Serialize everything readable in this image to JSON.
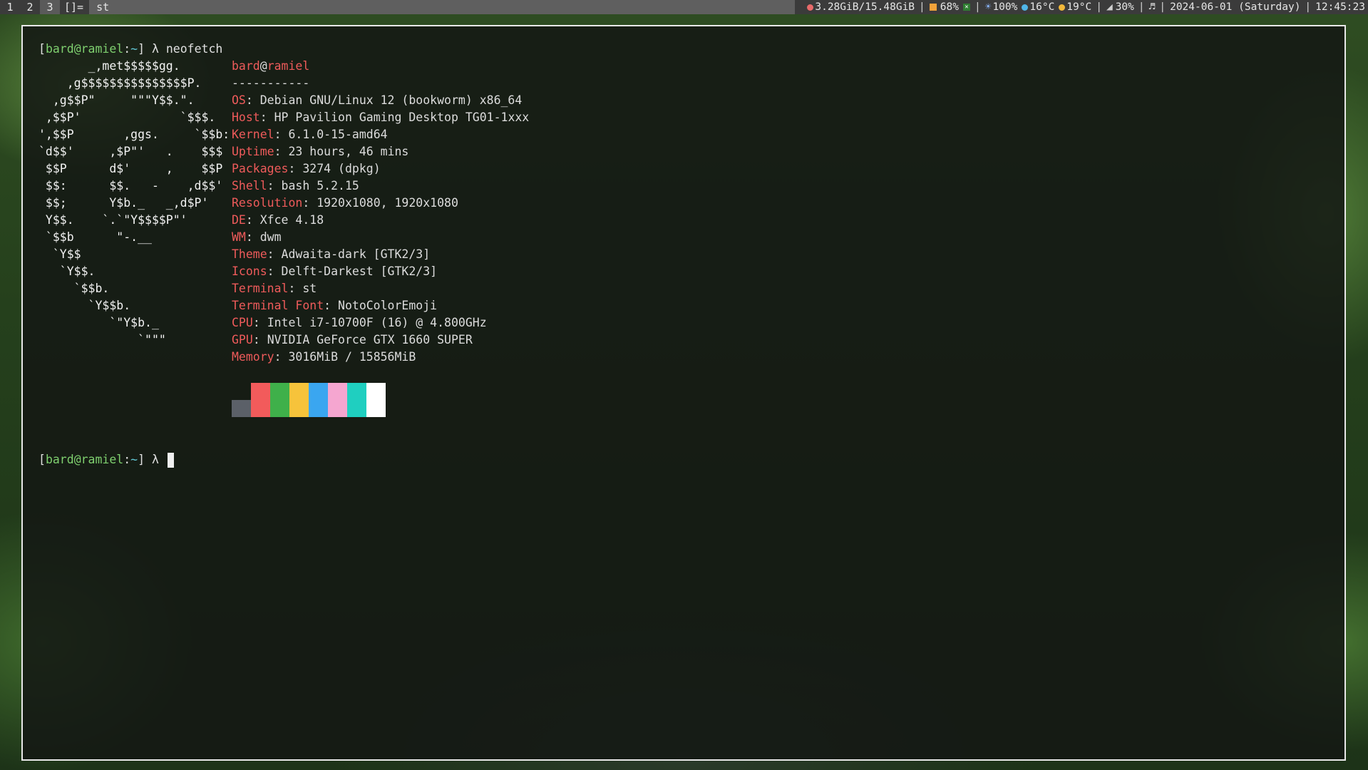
{
  "bar": {
    "tags": [
      "1",
      "2",
      "3"
    ],
    "active_tag": "3",
    "layout": "[]=",
    "window_title": "st",
    "memory": "3.28GiB/15.48GiB",
    "cpu": "68%",
    "brightness": "100%",
    "temp1": "16°C",
    "temp2": "19°C",
    "volume": "30%",
    "music": "♬",
    "date": "2024-06-01 (Saturday)",
    "time": "12:45:23",
    "icons": [
      "memory-icon",
      "cpu-icon",
      "cpu-status-icon",
      "brightness-icon",
      "weather-icon",
      "sun-icon",
      "volume-icon",
      "music-icon"
    ]
  },
  "terminal": {
    "prompt1": {
      "user": "bard",
      "host": "ramiel",
      "dir": "~",
      "symbol": "λ",
      "command": "neofetch"
    },
    "ascii_lines": [
      "       _,met$$$$$gg.",
      "    ,g$$$$$$$$$$$$$$$P.",
      "  ,g$$P\"     \"\"\"Y$$.\".",
      " ,$$P'              `$$$.",
      "',$$P       ,ggs.     `$$b:",
      "`d$$'     ,$P\"'   .    $$$",
      " $$P      d$'     ,    $$P",
      " $$:      $$.   -    ,d$$'",
      " $$;      Y$b._   _,d$P'",
      " Y$$.    `.`\"Y$$$$P\"'",
      " `$$b      \"-.__",
      "  `Y$$",
      "   `Y$$.",
      "     `$$b.",
      "       `Y$$b.",
      "          `\"Y$b._",
      "              `\"\"\""
    ],
    "title_user": "bard",
    "title_at": "@",
    "title_host": "ramiel",
    "separator": "-----------",
    "info": [
      {
        "key": "OS",
        "value": "Debian GNU/Linux 12 (bookworm) x86_64"
      },
      {
        "key": "Host",
        "value": "HP Pavilion Gaming Desktop TG01-1xxx"
      },
      {
        "key": "Kernel",
        "value": "6.1.0-15-amd64"
      },
      {
        "key": "Uptime",
        "value": "23 hours, 46 mins"
      },
      {
        "key": "Packages",
        "value": "3274 (dpkg)"
      },
      {
        "key": "Shell",
        "value": "bash 5.2.15"
      },
      {
        "key": "Resolution",
        "value": "1920x1080, 1920x1080"
      },
      {
        "key": "DE",
        "value": "Xfce 4.18"
      },
      {
        "key": "WM",
        "value": "dwm"
      },
      {
        "key": "Theme",
        "value": "Adwaita-dark [GTK2/3]"
      },
      {
        "key": "Icons",
        "value": "Delft-Darkest [GTK2/3]"
      },
      {
        "key": "Terminal",
        "value": "st"
      },
      {
        "key": "Terminal Font",
        "value": "NotoColorEmoji"
      },
      {
        "key": "CPU",
        "value": "Intel i7-10700F (16) @ 4.800GHz"
      },
      {
        "key": "GPU",
        "value": "NVIDIA GeForce GTX 1660 SUPER"
      },
      {
        "key": "Memory",
        "value": "3016MiB / 15856MiB"
      }
    ],
    "palette": [
      "#5b6068",
      "#f25b5b",
      "#3fb04a",
      "#f6c33b",
      "#3aa6f0",
      "#f5a6d0",
      "#1fcfc0",
      "#ffffff"
    ],
    "prompt2": {
      "user": "bard",
      "host": "ramiel",
      "dir": "~",
      "symbol": "λ"
    }
  }
}
